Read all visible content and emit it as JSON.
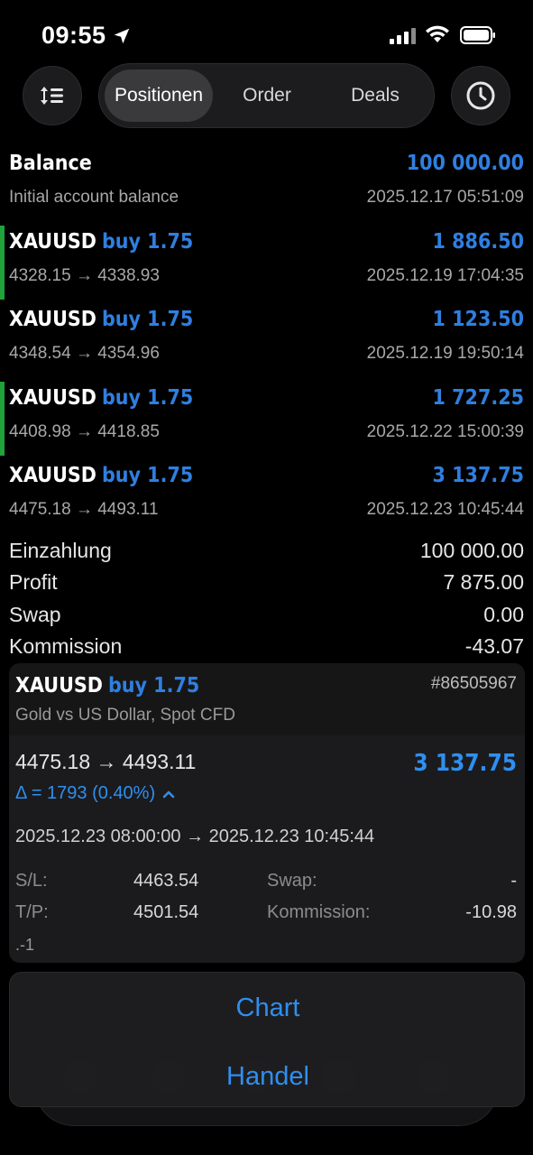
{
  "status_bar": {
    "time": "09:55"
  },
  "toolbar": {
    "tabs": [
      {
        "label": "Positionen",
        "active": true
      },
      {
        "label": "Order",
        "active": false
      },
      {
        "label": "Deals",
        "active": false
      }
    ]
  },
  "balance": {
    "label": "Balance",
    "value": "100 000.00",
    "sub": "Initial account balance",
    "date": "2025.12.17 05:51:09"
  },
  "deals": [
    {
      "symbol": "XAUUSD",
      "side": "buy 1.75",
      "prices": "4328.15 → 4338.93",
      "profit": "1 886.50",
      "date": "2025.12.19 17:04:35",
      "marker": true
    },
    {
      "symbol": "XAUUSD",
      "side": "buy 1.75",
      "prices": "4348.54 → 4354.96",
      "profit": "1 123.50",
      "date": "2025.12.19 19:50:14",
      "marker": false
    },
    {
      "symbol": "XAUUSD",
      "side": "buy 1.75",
      "prices": "4408.98 → 4418.85",
      "profit": "1 727.25",
      "date": "2025.12.22 15:00:39",
      "marker": true
    },
    {
      "symbol": "XAUUSD",
      "side": "buy 1.75",
      "prices": "4475.18 → 4493.11",
      "profit": "3 137.75",
      "date": "2025.12.23 10:45:44",
      "marker": false
    }
  ],
  "summary": [
    {
      "label": "Einzahlung",
      "value": "100 000.00"
    },
    {
      "label": "Profit",
      "value": "7 875.00"
    },
    {
      "label": "Swap",
      "value": "0.00"
    },
    {
      "label": "Kommission",
      "value": "-43.07"
    }
  ],
  "detail": {
    "symbol": "XAUUSD",
    "side": "buy 1.75",
    "ticket": "#86505967",
    "description": "Gold vs US Dollar, Spot CFD",
    "prices": "4475.18 → 4493.11",
    "profit": "3 137.75",
    "delta": "Δ = 1793 (0.40%)",
    "times": "2025.12.23 08:00:00 → 2025.12.23 10:45:44",
    "sl_label": "S/L:",
    "sl_value": "4463.54",
    "tp_label": "T/P:",
    "tp_value": "4501.54",
    "swap_label": "Swap:",
    "swap_value": "-",
    "commission_label": "Kommission:",
    "commission_value": "-10.98",
    "footer": ".-1"
  },
  "action_sheet": {
    "chart_label": "Chart",
    "trade_label": "Handel"
  },
  "colors": {
    "accent": "#2f7fe0",
    "profit_blue": "#2f8ff0",
    "marker_green": "#1fa33a",
    "background": "#000000"
  }
}
